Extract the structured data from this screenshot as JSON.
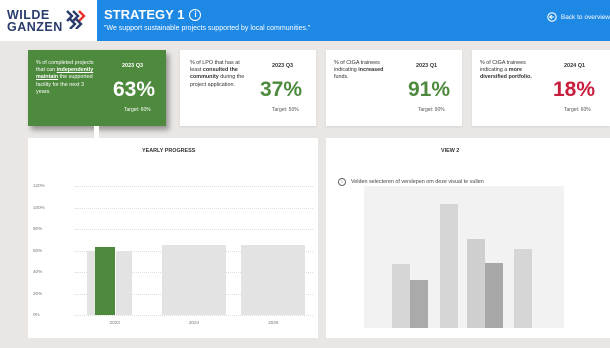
{
  "header": {
    "logo_line1": "WILDE",
    "logo_line2": "GANZEN",
    "title": "STRATEGY 1",
    "subtitle": "\"We support sustainable projects supported by local communities.\"",
    "back_label": "Back to overview"
  },
  "kpis": [
    {
      "desc_pre": "% of completed projects that can ",
      "desc_em": "independently maintain",
      "desc_post": " the supported facility for the next 3 years.",
      "period": "2023 Q3",
      "value": "63%",
      "target": "Target: 60%"
    },
    {
      "desc_pre": "% of LPO that has at least ",
      "desc_em": "consulted the community",
      "desc_post": " during the project application.",
      "period": "2023 Q3",
      "value": "37%",
      "target": "Target: 50%"
    },
    {
      "desc_pre": "% of CtGA trainees indicating ",
      "desc_em": "increased",
      "desc_post": " funds.",
      "period": "2023 Q1",
      "value": "91%",
      "target": "Target: 90%"
    },
    {
      "desc_pre": "% of CtGA trainees indicating a ",
      "desc_em": "more diversified portfolio.",
      "desc_post": "",
      "period": "2024 Q1",
      "value": "18%",
      "target": "Target: 60%"
    }
  ],
  "colors": {
    "brand_blue": "#1e88e5",
    "kpi_green": "#4e8a3e",
    "kpi_red": "#c81d3c",
    "target_bar": "#e3e3e3"
  },
  "chart_data": {
    "type": "bar",
    "title": "YEARLY PROGRESS",
    "categories": [
      "2023",
      "2024",
      "2025"
    ],
    "series": [
      {
        "values": [
          63,
          null,
          null
        ],
        "color": "#4e8a3e"
      },
      {
        "values": [
          60,
          65,
          65
        ],
        "color": "#e3e3e3"
      }
    ],
    "yticks": [
      "0%",
      "20%",
      "40%",
      "60%",
      "80%",
      "100%",
      "120%"
    ],
    "ylim": [
      0,
      120
    ],
    "xlabel": "",
    "ylabel": ""
  },
  "view2": {
    "title": "VIEW 2",
    "message": "Velden selecteren of verslepen om deze visual te vullen"
  }
}
